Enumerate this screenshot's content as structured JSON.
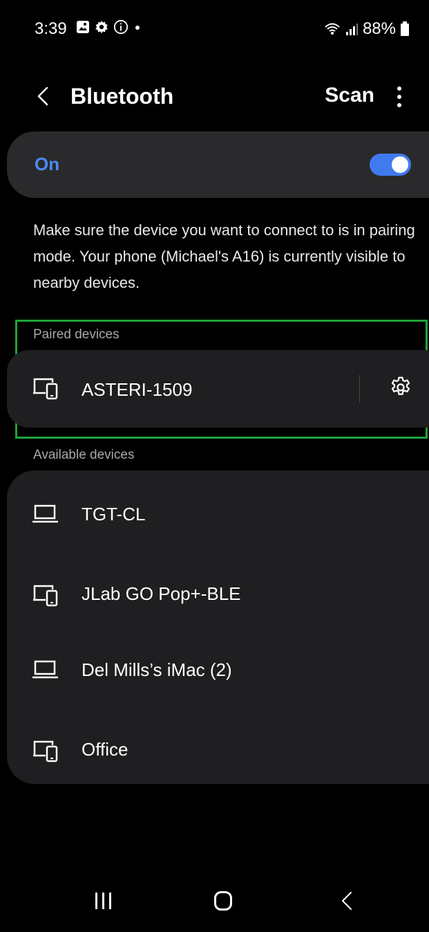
{
  "status_bar": {
    "time": "3:39",
    "icons_left": [
      "gallery-icon",
      "settings-icon",
      "info-icon",
      "dot-icon"
    ],
    "icons_right": [
      "wifi-icon",
      "signal-icon"
    ],
    "battery": "88%"
  },
  "header": {
    "title": "Bluetooth",
    "scan_label": "Scan"
  },
  "toggle": {
    "label": "On",
    "state": true,
    "accent_color": "#3f7bef"
  },
  "description": "Make sure the device you want to connect to is in pairing mode. Your phone (Michael's A16) is currently visible to nearby devices.",
  "paired": {
    "section_label": "Paired devices",
    "devices": [
      {
        "name": "ASTERI-1509",
        "icon": "devices-icon"
      }
    ]
  },
  "available": {
    "section_label": "Available devices",
    "devices": [
      {
        "name": "TGT-CL",
        "icon": "laptop-icon"
      },
      {
        "name": "JLab GO Pop+-BLE",
        "icon": "devices-icon"
      },
      {
        "name": "Del Mills’s iMac (2)",
        "icon": "laptop-icon"
      },
      {
        "name": "Office",
        "icon": "devices-icon"
      }
    ]
  }
}
